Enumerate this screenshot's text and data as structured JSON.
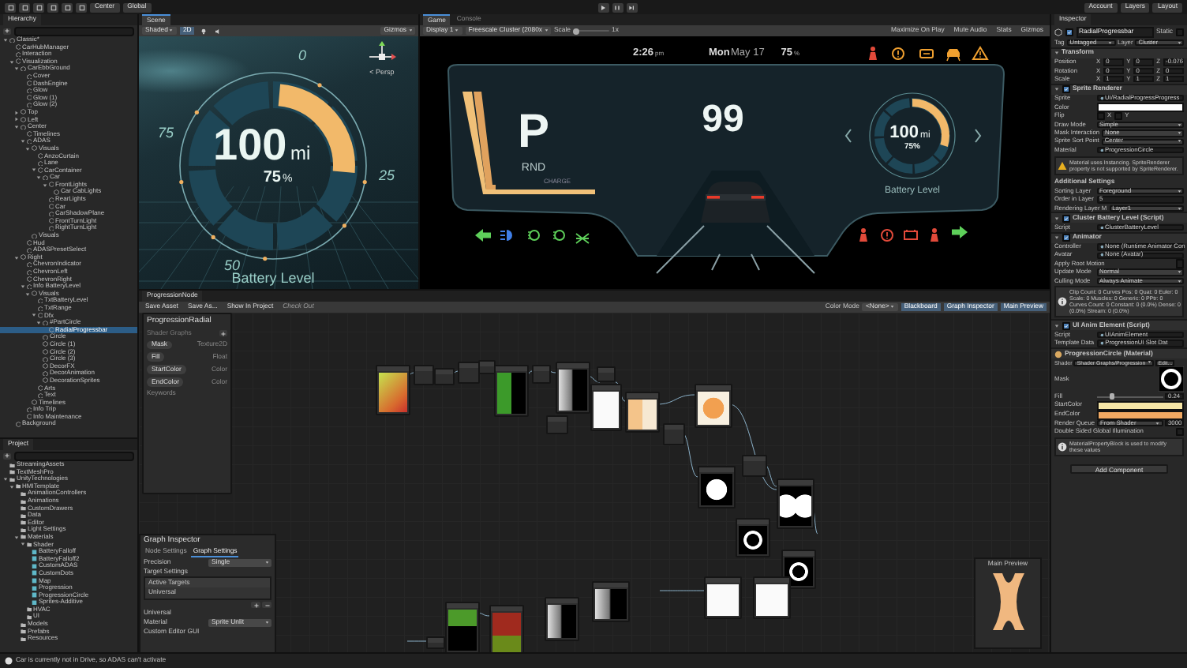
{
  "toolbar": {
    "pivot": "Center",
    "space": "Global",
    "menus": [
      "Account",
      "Layers",
      "Layout"
    ]
  },
  "hierarchy": {
    "title": "Hierarchy",
    "items": [
      {
        "name": "Classic*",
        "selected": false,
        "expanded": true,
        "children": [
          {
            "name": "CarHubManager",
            "selected": false
          },
          {
            "name": "Interaction",
            "selected": false
          },
          {
            "name": "Visualization",
            "selected": false,
            "expanded": true,
            "children": [
              {
                "name": "CarEbbGround",
                "selected": false,
                "expanded": true,
                "children": [
                  {
                    "name": "Cover",
                    "selected": false
                  },
                  {
                    "name": "DashEngine",
                    "selected": false
                  },
                  {
                    "name": "Glow",
                    "selected": false
                  },
                  {
                    "name": "Glow (1)",
                    "selected": false
                  },
                  {
                    "name": "Glow (2)",
                    "selected": false
                  }
                ]
              },
              {
                "name": "Top",
                "selected": false,
                "expanded": false
              },
              {
                "name": "Left",
                "selected": false,
                "expanded": false
              },
              {
                "name": "Center",
                "selected": false,
                "expanded": true,
                "children": [
                  {
                    "name": "Timelines",
                    "selected": false
                  },
                  {
                    "name": "ADAS",
                    "selected": false,
                    "expanded": true,
                    "children": [
                      {
                        "name": "Visuals",
                        "selected": false,
                        "expanded": true,
                        "children": [
                          {
                            "name": "AnzoCurtain",
                            "selected": false
                          },
                          {
                            "name": "Lane",
                            "selected": false
                          },
                          {
                            "name": "CarContainer",
                            "selected": false,
                            "expanded": true,
                            "children": [
                              {
                                "name": "Car",
                                "selected": false,
                                "expanded": true,
                                "children": [
                                  {
                                    "name": "FrontLights",
                                    "selected": false,
                                    "expanded": true,
                                    "children": [
                                      {
                                        "name": "Car CabLights",
                                        "selected": false
                                      }
                                    ]
                                  },
                                  {
                                    "name": "RearLights",
                                    "selected": false
                                  },
                                  {
                                    "name": "Car",
                                    "selected": false
                                  },
                                  {
                                    "name": "CarShadowPlane",
                                    "selected": false
                                  },
                                  {
                                    "name": "FrontTurnLight",
                                    "selected": false
                                  },
                                  {
                                    "name": "RightTurnLight",
                                    "selected": false
                                  }
                                ]
                              }
                            ]
                          }
                        ]
                      },
                      {
                        "name": "Visuals",
                        "selected": false
                      }
                    ]
                  },
                  {
                    "name": "Hud",
                    "selected": false
                  },
                  {
                    "name": "ADASPresetSelect",
                    "selected": false
                  }
                ]
              },
              {
                "name": "Right",
                "selected": false,
                "expanded": true,
                "children": [
                  {
                    "name": "ChevronIndicator",
                    "selected": false
                  },
                  {
                    "name": "ChevronLeft",
                    "selected": false
                  },
                  {
                    "name": "ChevronRight",
                    "selected": false
                  },
                  {
                    "name": "Info BatteryLevel",
                    "selected": false,
                    "expanded": true,
                    "children": [
                      {
                        "name": "Visuals",
                        "selected": false,
                        "expanded": true,
                        "children": [
                          {
                            "name": "TxtBatteryLevel",
                            "selected": false
                          },
                          {
                            "name": "TxtRange",
                            "selected": false
                          },
                          {
                            "name": "Dfx",
                            "selected": false,
                            "expanded": true,
                            "children": [
                              {
                                "name": "#PartCircle",
                                "selected": false,
                                "expanded": true,
                                "children": [
                                  {
                                    "name": "RadialProgressbar",
                                    "selected": true
                                  }
                                ]
                              },
                              {
                                "name": "Circle",
                                "selected": false
                              },
                              {
                                "name": "Circle (1)",
                                "selected": false
                              },
                              {
                                "name": "Circle (2)",
                                "selected": false
                              },
                              {
                                "name": "Circle (3)",
                                "selected": false
                              },
                              {
                                "name": "DecorFX",
                                "selected": false
                              },
                              {
                                "name": "DecorAnimation",
                                "selected": false
                              },
                              {
                                "name": "DecorationSprites",
                                "selected": false
                              }
                            ]
                          },
                          {
                            "name": "Arts",
                            "selected": false
                          },
                          {
                            "name": "Text",
                            "selected": false
                          }
                        ]
                      },
                      {
                        "name": "Timelines",
                        "selected": false
                      }
                    ]
                  },
                  {
                    "name": "Info Trip",
                    "selected": false
                  },
                  {
                    "name": "Info Maintenance",
                    "selected": false
                  }
                ]
              }
            ]
          },
          {
            "name": "Background",
            "selected": false
          }
        ]
      }
    ]
  },
  "project": {
    "title": "Project",
    "items": [
      {
        "name": "StreamingAssets",
        "kind": "folder"
      },
      {
        "name": "TextMeshPro",
        "kind": "folder"
      },
      {
        "name": "UnityTechnologies",
        "kind": "folder",
        "expanded": true,
        "children": [
          {
            "name": "HMITemplate",
            "kind": "folder",
            "expanded": true,
            "children": [
              {
                "name": "AnimationControllers",
                "kind": "folder"
              },
              {
                "name": "Animations",
                "kind": "folder"
              },
              {
                "name": "CustomDrawers",
                "kind": "folder"
              },
              {
                "name": "Data",
                "kind": "folder"
              },
              {
                "name": "Editor",
                "kind": "folder"
              },
              {
                "name": "Light Settings",
                "kind": "folder"
              },
              {
                "name": "Materials",
                "kind": "folder",
                "expanded": true,
                "children": [
                  {
                    "name": "Shader",
                    "kind": "folder",
                    "expanded": true,
                    "children": [
                      {
                        "name": "BatteryFalloff",
                        "kind": "shader"
                      },
                      {
                        "name": "BatteryFalloff2",
                        "kind": "shader"
                      },
                      {
                        "name": "CustomADAS",
                        "kind": "shader"
                      },
                      {
                        "name": "CustomDots",
                        "kind": "shader"
                      },
                      {
                        "name": "Map",
                        "kind": "shader"
                      },
                      {
                        "name": "Progression",
                        "kind": "shader"
                      },
                      {
                        "name": "ProgressionCircle",
                        "kind": "shader"
                      },
                      {
                        "name": "Sprites-Additive",
                        "kind": "shader"
                      }
                    ]
                  },
                  {
                    "name": "HVAC",
                    "kind": "folder"
                  },
                  {
                    "name": "UI",
                    "kind": "folder"
                  }
                ]
              },
              {
                "name": "Models",
                "kind": "folder"
              },
              {
                "name": "Prefabs",
                "kind": "folder"
              },
              {
                "name": "Resources",
                "kind": "folder"
              }
            ]
          }
        ]
      }
    ]
  },
  "scene": {
    "tab": "Scene",
    "shading": "Shaded",
    "mode_2d": "2D",
    "gizmos": "Gizmos",
    "persp": "< Persp",
    "gauge": {
      "ticks": [
        "0",
        "25",
        "50",
        "75"
      ],
      "value": "100",
      "unit": "mi",
      "percent": "75",
      "percent_unit": "%",
      "label": "Battery Level",
      "level": 0.25
    }
  },
  "game": {
    "tabs": [
      {
        "label": "Game",
        "selected": true
      },
      {
        "label": "Console",
        "selected": false
      }
    ],
    "display": "Display 1",
    "resolution": "Freescale Cluster (2080x",
    "scale": {
      "label": "Scale",
      "value": "1x",
      "level": 0.05
    },
    "toggles": [
      {
        "label": "Maximize On Play",
        "on": false
      },
      {
        "label": "Mute Audio",
        "on": false
      },
      {
        "label": "Stats",
        "on": false
      },
      {
        "label": "Gizmos",
        "on": false
      }
    ],
    "cluster": {
      "time": "2:26",
      "time_suffix": "pm",
      "day": "Mon",
      "date": "May 17",
      "temp": "75",
      "temp_unit": "%",
      "gear": "P",
      "gear_options": "RND",
      "speed": "99",
      "charge_label": "CHARGE",
      "battery": {
        "value": "100",
        "unit": "mi",
        "percent": "75%",
        "label": "Battery Level",
        "level": 0.3
      }
    }
  },
  "graph": {
    "tab": "ProgressionNode",
    "buttons": [
      {
        "label": "Save Asset",
        "disabled": false
      },
      {
        "label": "Save As...",
        "disabled": false
      },
      {
        "label": "Show In Project",
        "disabled": false
      },
      {
        "label": "Check Out",
        "disabled": true
      }
    ],
    "color_mode_label": "Color Mode",
    "color_mode": "<None>",
    "toggles": [
      {
        "label": "Blackboard",
        "on": true
      },
      {
        "label": "Graph Inspector",
        "on": true
      },
      {
        "label": "Main Preview",
        "on": true
      }
    ],
    "blackboard": {
      "title": "ProgressionRadial",
      "subtitle": "Shader Graphs",
      "properties": [
        {
          "name": "Mask",
          "type": "Texture2D"
        },
        {
          "name": "Fill",
          "type": "Float"
        },
        {
          "name": "StartColor",
          "type": "Color"
        },
        {
          "name": "EndColor",
          "type": "Color"
        }
      ],
      "keywords": "Keywords"
    },
    "inspector": {
      "title": "Graph Inspector",
      "tabs": [
        {
          "label": "Node Settings",
          "selected": false
        },
        {
          "label": "Graph Settings",
          "selected": true
        }
      ],
      "precision_label": "Precision",
      "precision": "Single",
      "target_settings": "Target Settings",
      "active_targets": "Active Targets",
      "targets": [
        "Universal"
      ],
      "section": "Universal",
      "material_label": "Material",
      "material": "Sprite Unlit",
      "custom_editor": "Custom Editor GUI"
    },
    "preview": {
      "title": "Main Preview"
    }
  },
  "inspector": {
    "title": "Inspector",
    "object": {
      "name": "RadialProgressbar",
      "active": true,
      "static_label": "Static",
      "static": false,
      "tag_label": "Tag",
      "tag": "Untagged",
      "layer_label": "Layer",
      "layer": "Cluster"
    },
    "components": [
      {
        "title": "Transform",
        "rows": [
          {
            "kind": "xyz",
            "label": "Position",
            "axes": [
              "X",
              "Y",
              "Z"
            ],
            "values": [
              "0",
              "0",
              "-0.076"
            ]
          },
          {
            "kind": "xyz",
            "label": "Rotation",
            "axes": [
              "X",
              "Y",
              "Z"
            ],
            "values": [
              "0",
              "0",
              "0"
            ]
          },
          {
            "kind": "xyz",
            "label": "Scale",
            "axes": [
              "X",
              "Y",
              "Z"
            ],
            "values": [
              "1",
              "1",
              "1"
            ]
          }
        ]
      },
      {
        "title": "Sprite Renderer",
        "enabled": true,
        "rows": [
          {
            "kind": "object",
            "label": "Sprite",
            "value": "UI/RadialProgressProgress"
          },
          {
            "kind": "color",
            "label": "Color",
            "color": "#ffffff"
          },
          {
            "kind": "flip",
            "label": "Flip",
            "values": [
              {
                "label": "X",
                "checked": false
              },
              {
                "label": "Y",
                "checked": false
              }
            ]
          },
          {
            "kind": "dropdown",
            "label": "Draw Mode",
            "value": "Simple"
          },
          {
            "kind": "dropdown",
            "label": "Mask Interaction",
            "value": "None"
          },
          {
            "kind": "dropdown",
            "label": "Sprite Sort Point",
            "value": "Center"
          },
          {
            "kind": "object",
            "label": "Material",
            "value": "ProgressionCircle"
          },
          {
            "kind": "warning",
            "text": "Material uses Instancing. SpriteRenderer property is not supported by SpriteRenderer."
          },
          {
            "kind": "heading",
            "text": "Additional Settings"
          },
          {
            "kind": "dropdown",
            "label": "Sorting Layer",
            "value": "Foreground"
          },
          {
            "kind": "text",
            "label": "Order in Layer",
            "value": "5"
          },
          {
            "kind": "dropdown",
            "label": "Rendering Layer M",
            "value": "Layer1"
          }
        ]
      },
      {
        "title": "Cluster Battery Level (Script)",
        "enabled": true,
        "rows": [
          {
            "kind": "object",
            "label": "Script",
            "value": "ClusterBatteryLevel"
          }
        ]
      },
      {
        "title": "Animator",
        "enabled": true,
        "rows": [
          {
            "kind": "object",
            "label": "Controller",
            "value": "None (Runtime Animator Con"
          },
          {
            "kind": "object",
            "label": "Avatar",
            "value": "None (Avatar)"
          },
          {
            "kind": "checkbox",
            "label": "Apply Root Motion",
            "checked": false
          },
          {
            "kind": "dropdown",
            "label": "Update Mode",
            "value": "Normal"
          },
          {
            "kind": "dropdown",
            "label": "Culling Mode",
            "value": "Always Animate"
          },
          {
            "kind": "info",
            "text": "Clip Count: 0 Curves Pos: 0 Quat: 0 Euler: 0 Scale: 0 Muscles: 0 Generic: 0 PPtr: 0 Curves Count: 0 Constant: 0 (0.0%) Dense: 0 (0.0%) Stream: 0 (0.0%)"
          }
        ]
      },
      {
        "title": "UI Anim Element (Script)",
        "enabled": true,
        "rows": [
          {
            "kind": "object",
            "label": "Script",
            "value": "UIAnimElement"
          },
          {
            "kind": "object",
            "label": "Template Data",
            "value": "ProgressionUI Slot Dat"
          }
        ]
      }
    ],
    "material": {
      "name": "ProgressionCircle (Material)",
      "shader_label": "Shader",
      "shader": "Shader Graphs/Progression",
      "edit": "Edit...",
      "rows": [
        {
          "kind": "texture",
          "label": "Mask"
        },
        {
          "kind": "slider",
          "label": "Fill",
          "level": 0.24,
          "value": "0.24"
        },
        {
          "kind": "color",
          "label": "StartColor",
          "color": "#f6e6a6"
        },
        {
          "kind": "color",
          "label": "EndColor",
          "color": "#f0a862"
        },
        {
          "kind": "queue",
          "label": "Render Queue",
          "value": "From Shader",
          "number": "3000"
        },
        {
          "kind": "checkbox",
          "label": "Double Sided Global Illumination",
          "checked": false
        },
        {
          "kind": "info",
          "text": "MaterialPropertyBlock is used to modify these values"
        }
      ]
    },
    "add_component": "Add Component"
  },
  "status_bar": {
    "message": "Car is currently not in Drive, so ADAS can't activate"
  }
}
